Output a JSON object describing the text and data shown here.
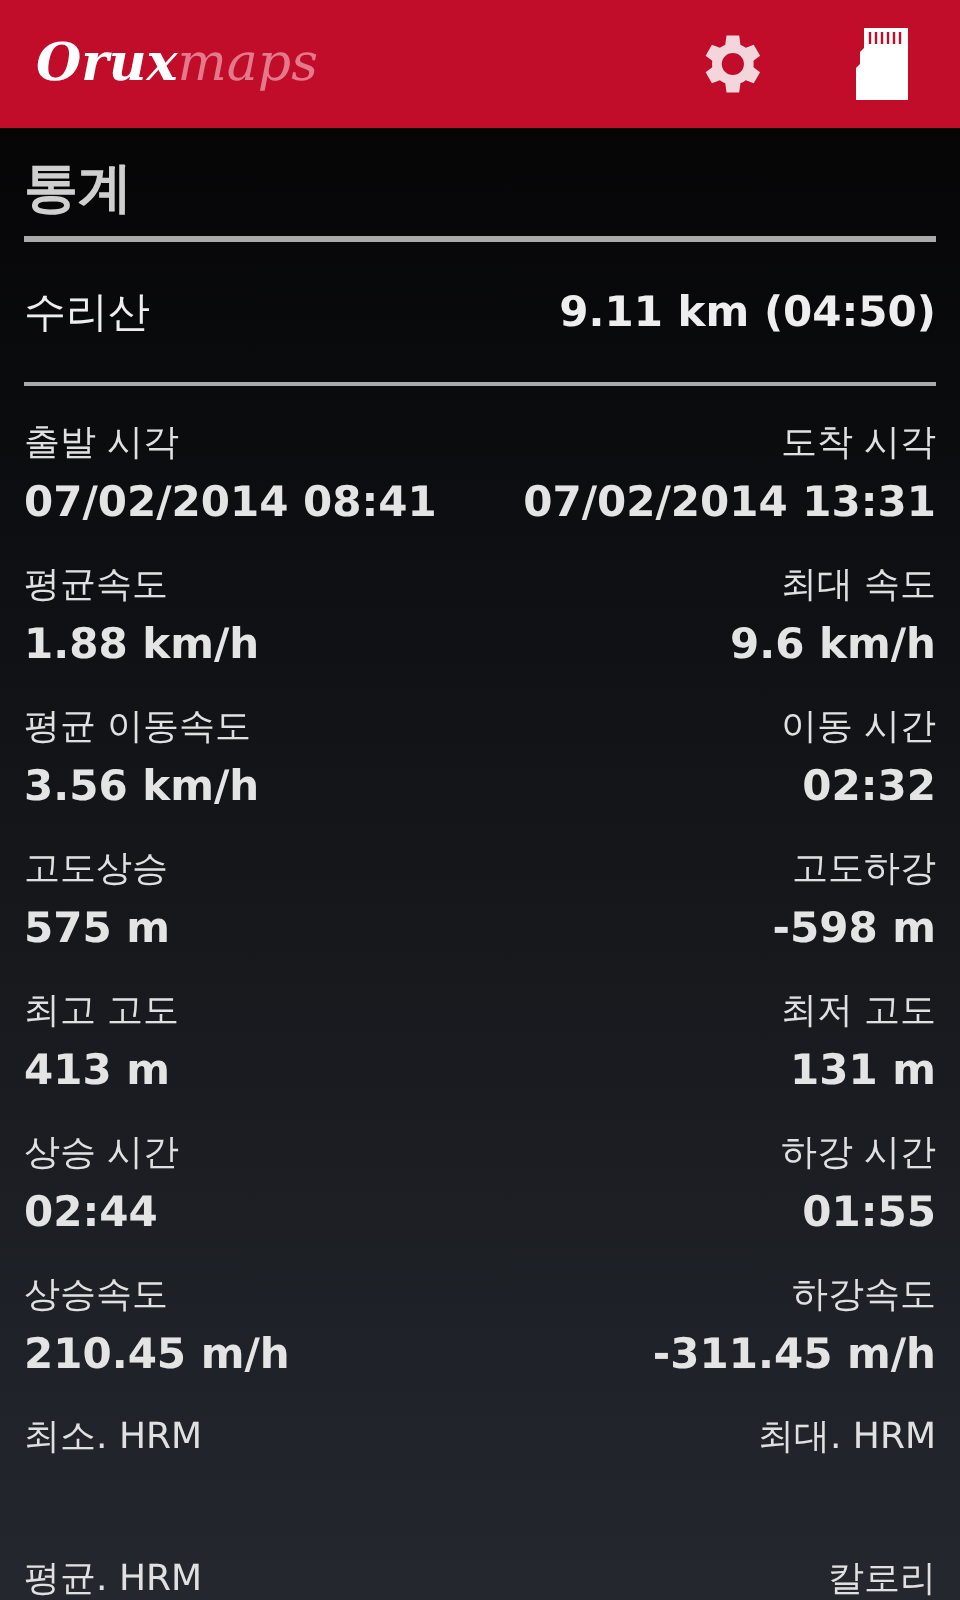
{
  "app_bar": {
    "logo": {
      "first": "Orux",
      "second": "maps"
    }
  },
  "title": "통계",
  "track": {
    "name": "수리산",
    "summary": "9.11 km (04:50)"
  },
  "stats": [
    {
      "left": {
        "label": "출발 시각",
        "value": "07/02/2014 08:41"
      },
      "right": {
        "label": "도착 시각",
        "value": "07/02/2014 13:31"
      }
    },
    {
      "left": {
        "label": "평균속도",
        "value": "1.88 km/h"
      },
      "right": {
        "label": "최대 속도",
        "value": "9.6 km/h"
      }
    },
    {
      "left": {
        "label": "평균 이동속도",
        "value": "3.56 km/h"
      },
      "right": {
        "label": "이동 시간",
        "value": "02:32"
      }
    },
    {
      "left": {
        "label": "고도상승",
        "value": "575 m"
      },
      "right": {
        "label": "고도하강",
        "value": "-598 m"
      }
    },
    {
      "left": {
        "label": "최고 고도",
        "value": "413 m"
      },
      "right": {
        "label": "최저 고도",
        "value": "131 m"
      }
    },
    {
      "left": {
        "label": "상승 시간",
        "value": "02:44"
      },
      "right": {
        "label": "하강 시간",
        "value": "01:55"
      }
    },
    {
      "left": {
        "label": "상승속도",
        "value": "210.45 m/h"
      },
      "right": {
        "label": "하강속도",
        "value": "-311.45 m/h"
      }
    },
    {
      "left": {
        "label": "최소. HRM"
      },
      "right": {
        "label": "최대. HRM"
      }
    },
    {
      "left": {
        "label": "평균. HRM"
      },
      "right": {
        "label": "칼로리"
      }
    }
  ]
}
